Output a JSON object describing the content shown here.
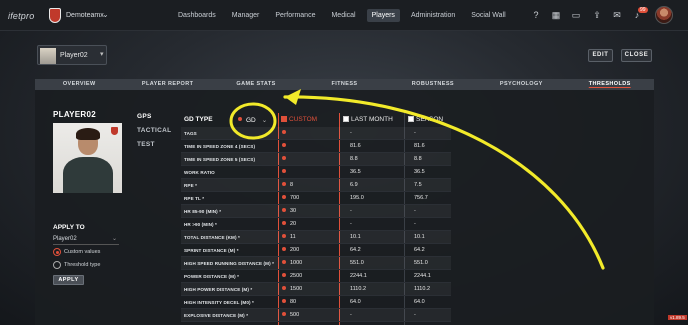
{
  "app": {
    "brand": "ifetpro",
    "team": "Demoteamx"
  },
  "nav": [
    "Dashboards",
    "Manager",
    "Performance",
    "Medical",
    "Players",
    "Administration",
    "Social Wall"
  ],
  "nav_active": "Players",
  "notifications_badge": "99",
  "player": {
    "selector_name": "Player02",
    "title": "PLAYER02"
  },
  "actions": {
    "edit": "EDIT",
    "close": "CLOSE"
  },
  "tabs": [
    "OVERVIEW",
    "PLAYER REPORT",
    "GAME STATS",
    "FITNESS",
    "ROBUSTNESS",
    "PSYCHOLOGY",
    "THRESHOLDS"
  ],
  "active_tab": "THRESHOLDS",
  "side_links": [
    "GPS",
    "TACTICAL",
    "TEST"
  ],
  "apply": {
    "title": "APPLY TO",
    "selected": "Player02",
    "custom_values": "Custom values",
    "threshold_type": "Threshold type",
    "button": "APPLY"
  },
  "table": {
    "gd_type_label": "GD TYPE",
    "gd_value": "GD",
    "columns": {
      "custom": "CUSTOM",
      "last_month": "LAST MONTH",
      "season": "SEASON"
    },
    "rows": [
      {
        "label": "TAGS",
        "custom": "",
        "last_month": "-",
        "season": "-"
      },
      {
        "label": "TIME IN SPEED ZONE 4 (SECS)",
        "custom": "",
        "last_month": "81.6",
        "season": "81.6"
      },
      {
        "label": "TIME IN SPEED ZONE 5 (SECS)",
        "custom": "",
        "last_month": "8.8",
        "season": "8.8"
      },
      {
        "label": "WORK RATIO",
        "custom": "",
        "last_month": "36.5",
        "season": "36.5"
      },
      {
        "label": "RPE *",
        "custom": "8",
        "last_month": "6.9",
        "season": "7.5"
      },
      {
        "label": "RPE TL *",
        "custom": "700",
        "last_month": "195.0",
        "season": "756.7"
      },
      {
        "label": "HR 85-90 (MIN) *",
        "custom": "30",
        "last_month": "-",
        "season": "-"
      },
      {
        "label": "HR >90 (MIN) *",
        "custom": "20",
        "last_month": "-",
        "season": "-"
      },
      {
        "label": "TOTAL DISTANCE (KM) *",
        "custom": "11",
        "last_month": "10.1",
        "season": "10.1"
      },
      {
        "label": "SPRINT DISTANCE (M) *",
        "custom": "200",
        "last_month": "64.2",
        "season": "64.2"
      },
      {
        "label": "HIGH SPEED RUNNING DISTANCE (M) *",
        "custom": "1000",
        "last_month": "551.0",
        "season": "551.0"
      },
      {
        "label": "POWER DISTANCE (M) *",
        "custom": "2500",
        "last_month": "2244.1",
        "season": "2244.1"
      },
      {
        "label": "HIGH POWER DISTANCE (M) *",
        "custom": "1500",
        "last_month": "1110.2",
        "season": "1110.2"
      },
      {
        "label": "HIGH INTENSITY DECEL (M0) *",
        "custom": "80",
        "last_month": "64.0",
        "season": "64.0"
      },
      {
        "label": "EXPLOSIVE DISTANCE (M) *",
        "custom": "500",
        "last_month": "-",
        "season": "-"
      }
    ]
  },
  "version": "v1.89.5",
  "colors": {
    "accent": "#e0503a",
    "annotation": "#f2ea2a"
  }
}
